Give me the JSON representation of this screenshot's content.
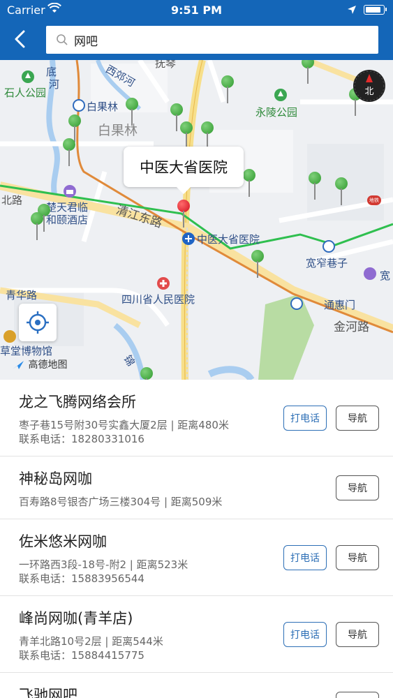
{
  "status": {
    "carrier": "Carrier",
    "time": "9:51 PM",
    "battery_level": 0.9
  },
  "header": {
    "search_value": "网吧"
  },
  "map": {
    "callout": "中医大省医院",
    "labels": {
      "shiren_park": "石人公园",
      "baiguolin_small": "白果林",
      "baiguolin_big": "白果林",
      "yongling_park": "永陵公园",
      "chutian_hotel_1": "楚天君临",
      "chutian_hotel_2": "和颐酒店",
      "qingjiang_road": "清江东路",
      "tcm_hospital_station": "中医大省医院",
      "kuanzhai_alley": "宽窄巷子",
      "qinghua_road": "青华路",
      "sichuan_hospital": "四川省人民医院",
      "tonghui_gate": "通惠门",
      "jinhe_road": "金河路",
      "caotang_museum": "草堂博物馆",
      "xijiao_river": "西郊河",
      "di_river": "河",
      "di_char": "底",
      "north_road": "北路",
      "kuan": "宽",
      "jin": "锦",
      "fu": "抚琴",
      "compass_label": "北",
      "metro_badge": "地铁"
    },
    "logo": "高德地图"
  },
  "results": [
    {
      "name": "龙之飞腾网络会所",
      "address": "枣子巷15号附30号实鑫大厦2层 | 距离480米",
      "phone": "联系电话：18280331016",
      "call_label": "打电话",
      "nav_label": "导航"
    },
    {
      "name": "神秘岛网咖",
      "address": "百寿路8号银杏广场三楼304号 | 距离509米",
      "phone": "",
      "call_label": "",
      "nav_label": "导航"
    },
    {
      "name": "佐米悠米网咖",
      "address": "一环路西3段-18号-附2 | 距离523米",
      "phone": "联系电话：15883956544",
      "call_label": "打电话",
      "nav_label": "导航"
    },
    {
      "name": "峰尚网咖(青羊店)",
      "address": "青羊北路10号2层 | 距离544米",
      "phone": "联系电话：15884415775",
      "call_label": "打电话",
      "nav_label": "导航"
    },
    {
      "name": "飞驰网吧",
      "address": "",
      "phone": "",
      "call_label": "",
      "nav_label": "导航"
    }
  ]
}
